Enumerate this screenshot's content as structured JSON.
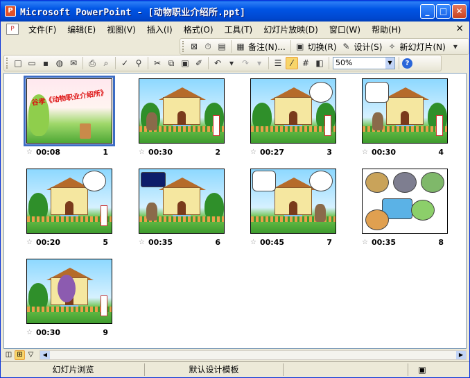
{
  "window": {
    "title": "Microsoft PowerPoint - [动物职业介绍所.ppt]",
    "app_icon_text": "P",
    "buttons": {
      "minimize": "_",
      "maximize": "□",
      "close": "✕"
    }
  },
  "menubar": {
    "items": [
      "文件(F)",
      "编辑(E)",
      "视图(V)",
      "插入(I)",
      "格式(O)",
      "工具(T)",
      "幻灯片放映(D)",
      "窗口(W)",
      "帮助(H)"
    ],
    "close_label": "×"
  },
  "toolbar_sorter": {
    "notes_label": "备注(N)...",
    "transition_label": "切换(R)",
    "design_label": "设计(S)",
    "new_slide_label": "新幻灯片(N)"
  },
  "toolbar_standard": {
    "zoom_value": "50%",
    "help_label": "?"
  },
  "slides": [
    {
      "number": "1",
      "time": "00:08",
      "star": "☆",
      "title": "谷孝《动物职业介绍所》",
      "selected": true
    },
    {
      "number": "2",
      "time": "00:30",
      "star": "☆"
    },
    {
      "number": "3",
      "time": "00:27",
      "star": "☆"
    },
    {
      "number": "4",
      "time": "00:30",
      "star": "☆"
    },
    {
      "number": "5",
      "time": "00:20",
      "star": "☆"
    },
    {
      "number": "6",
      "time": "00:35",
      "star": "☆"
    },
    {
      "number": "7",
      "time": "00:45",
      "star": "☆"
    },
    {
      "number": "8",
      "time": "00:35",
      "star": "☆"
    },
    {
      "number": "9",
      "time": "00:30",
      "star": "☆"
    }
  ],
  "statusbar": {
    "view_name": "幻灯片浏览",
    "template_name": "默认设计模板"
  },
  "colors": {
    "titlebar": "#0055e5",
    "selection": "#3c6cc4",
    "cover_title": "#dd1111"
  }
}
